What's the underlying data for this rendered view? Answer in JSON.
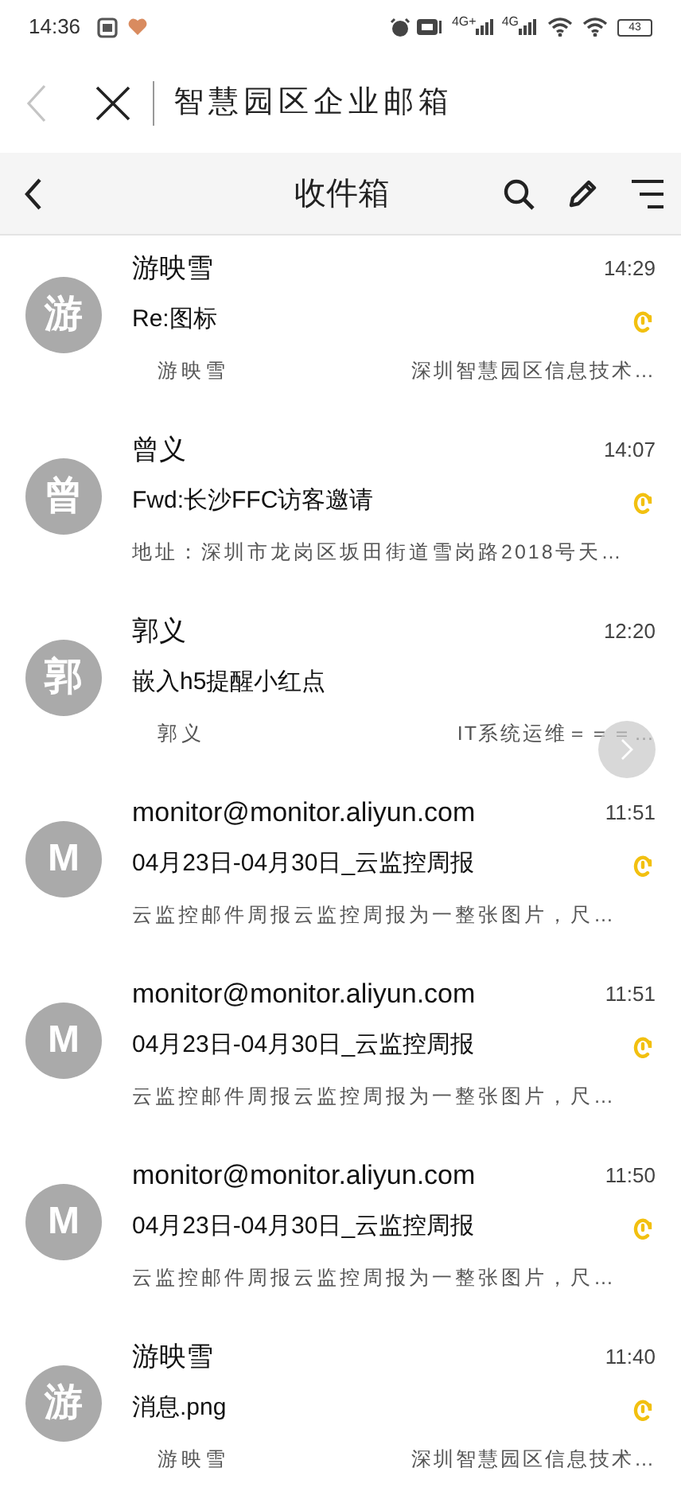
{
  "status_bar": {
    "time": "14:36",
    "network_1": "4G+",
    "network_2": "4G",
    "battery": "43"
  },
  "top_bar": {
    "title": "智慧园区企业邮箱"
  },
  "header": {
    "title": "收件箱"
  },
  "emails": [
    {
      "avatar": "游",
      "sender": "游映雪",
      "time": "14:29",
      "subject": "Re:图标",
      "attachment": true,
      "preview": [
        "游映雪",
        "深圳智慧园区信息技术…"
      ]
    },
    {
      "avatar": "曾",
      "sender": "曾义",
      "time": "14:07",
      "subject": "Fwd:长沙FFC访客邀请",
      "attachment": true,
      "preview": [
        "地址：深圳市龙岗区坂田街道雪岗路2018号天…"
      ]
    },
    {
      "avatar": "郭",
      "sender": "郭义",
      "time": "12:20",
      "subject": "嵌入h5提醒小红点",
      "attachment": false,
      "preview": [
        "郭义",
        "IT系统运维＝＝＝…"
      ]
    },
    {
      "avatar": "M",
      "sender": "monitor@monitor.aliyun.com",
      "time": "11:51",
      "subject": "04月23日-04月30日_云监控周报",
      "attachment": true,
      "preview": [
        "云监控邮件周报云监控周报为一整张图片，尺…"
      ]
    },
    {
      "avatar": "M",
      "sender": "monitor@monitor.aliyun.com",
      "time": "11:51",
      "subject": "04月23日-04月30日_云监控周报",
      "attachment": true,
      "preview": [
        "云监控邮件周报云监控周报为一整张图片，尺…"
      ]
    },
    {
      "avatar": "M",
      "sender": "monitor@monitor.aliyun.com",
      "time": "11:50",
      "subject": "04月23日-04月30日_云监控周报",
      "attachment": true,
      "preview": [
        "云监控邮件周报云监控周报为一整张图片，尺…"
      ]
    },
    {
      "avatar": "游",
      "sender": "游映雪",
      "time": "11:40",
      "subject": "消息.png",
      "attachment": true,
      "preview": [
        "游映雪",
        "深圳智慧园区信息技术…"
      ]
    }
  ]
}
